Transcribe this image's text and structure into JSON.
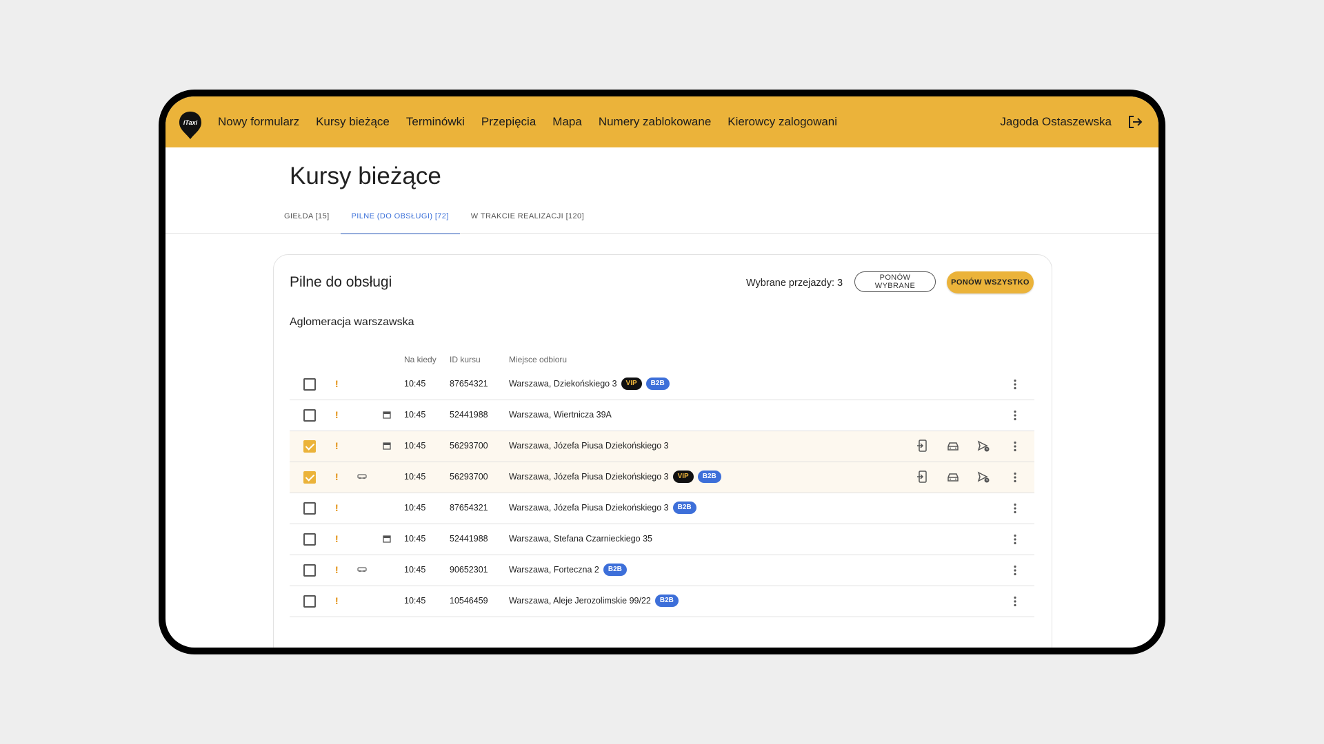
{
  "nav": {
    "logo_text": "iTaxi",
    "items": [
      "Nowy formularz",
      "Kursy bieżące",
      "Terminówki",
      "Przepięcia",
      "Mapa",
      "Numery zablokowane",
      "Kierowcy zalogowani"
    ],
    "user_name": "Jagoda Ostaszewska"
  },
  "page": {
    "title": "Kursy bieżące",
    "tabs": [
      {
        "label": "GIEŁDA [15]",
        "active": false
      },
      {
        "label": "PILNE (DO OBSŁUGI) [72]",
        "active": true
      },
      {
        "label": "W TRAKCIE REALIZACJI [120]",
        "active": false
      }
    ]
  },
  "card": {
    "title": "Pilne do obsługi",
    "selected_count": "Wybrane przejazdy: 3",
    "retry_selected": "PONÓW WYBRANE",
    "retry_all": "PONÓW WSZYSTKO",
    "region": "Aglomeracja warszawska",
    "columns": {
      "when": "Na kiedy",
      "id": "ID kursu",
      "pickup": "Miejsce odbioru"
    }
  },
  "rows": [
    {
      "checked": false,
      "car": false,
      "calendar": false,
      "time": "10:45",
      "id": "87654321",
      "address": "Warszawa, Dziekońskiego 3",
      "vip": "VIP",
      "b2b": "B2B",
      "actions": false
    },
    {
      "checked": false,
      "car": false,
      "calendar": true,
      "time": "10:45",
      "id": "52441988",
      "address": "Warszawa, Wiertnicza 39A",
      "vip": null,
      "b2b": null,
      "actions": false
    },
    {
      "checked": true,
      "car": false,
      "calendar": true,
      "time": "10:45",
      "id": "56293700",
      "address": "Warszawa, Józefa Piusa Dziekońskiego 3",
      "vip": null,
      "b2b": null,
      "actions": true
    },
    {
      "checked": true,
      "car": true,
      "calendar": false,
      "time": "10:45",
      "id": "56293700",
      "address": "Warszawa, Józefa Piusa Dziekońskiego 3",
      "vip": "VIP",
      "b2b": "B2B",
      "actions": true
    },
    {
      "checked": false,
      "car": false,
      "calendar": false,
      "time": "10:45",
      "id": "87654321",
      "address": "Warszawa, Józefa Piusa Dziekońskiego 3",
      "vip": null,
      "b2b": "B2B",
      "actions": false
    },
    {
      "checked": false,
      "car": false,
      "calendar": true,
      "time": "10:45",
      "id": "52441988",
      "address": "Warszawa, Stefana Czarnieckiego 35",
      "vip": null,
      "b2b": null,
      "actions": false
    },
    {
      "checked": false,
      "car": true,
      "calendar": false,
      "time": "10:45",
      "id": "90652301",
      "address": "Warszawa, Forteczna 2",
      "vip": null,
      "b2b": "B2B",
      "actions": false
    },
    {
      "checked": false,
      "car": false,
      "calendar": false,
      "time": "10:45",
      "id": "10546459",
      "address": "Warszawa, Aleje Jerozolimskie 99/22",
      "vip": null,
      "b2b": "B2B",
      "actions": false
    }
  ],
  "urgent_mark": "!",
  "colors": {
    "brand": "#ebb33a",
    "accent": "#3a6fd8",
    "b2b": "#3d6fd9",
    "vip_bg": "#111111"
  },
  "icons": [
    "itaxi-logo-icon",
    "logout-icon",
    "checkbox-icon",
    "urgent-icon",
    "car-icon",
    "calendar-icon",
    "reassign-phone-icon",
    "taxi-icon",
    "send-scheduled-icon",
    "more-vert-icon"
  ]
}
